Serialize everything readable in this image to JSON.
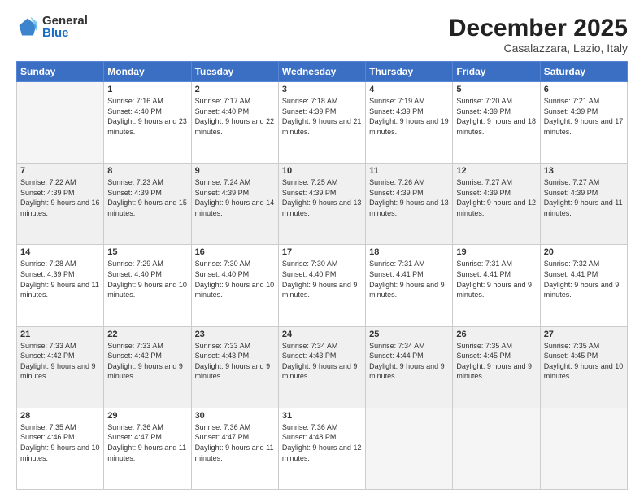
{
  "logo": {
    "general": "General",
    "blue": "Blue"
  },
  "header": {
    "month": "December 2025",
    "location": "Casalazzara, Lazio, Italy"
  },
  "days_of_week": [
    "Sunday",
    "Monday",
    "Tuesday",
    "Wednesday",
    "Thursday",
    "Friday",
    "Saturday"
  ],
  "weeks": [
    [
      {
        "day": "",
        "empty": true
      },
      {
        "day": "1",
        "sunrise": "7:16 AM",
        "sunset": "4:40 PM",
        "daylight": "9 hours and 23 minutes."
      },
      {
        "day": "2",
        "sunrise": "7:17 AM",
        "sunset": "4:40 PM",
        "daylight": "9 hours and 22 minutes."
      },
      {
        "day": "3",
        "sunrise": "7:18 AM",
        "sunset": "4:39 PM",
        "daylight": "9 hours and 21 minutes."
      },
      {
        "day": "4",
        "sunrise": "7:19 AM",
        "sunset": "4:39 PM",
        "daylight": "9 hours and 19 minutes."
      },
      {
        "day": "5",
        "sunrise": "7:20 AM",
        "sunset": "4:39 PM",
        "daylight": "9 hours and 18 minutes."
      },
      {
        "day": "6",
        "sunrise": "7:21 AM",
        "sunset": "4:39 PM",
        "daylight": "9 hours and 17 minutes."
      }
    ],
    [
      {
        "day": "7",
        "sunrise": "7:22 AM",
        "sunset": "4:39 PM",
        "daylight": "9 hours and 16 minutes."
      },
      {
        "day": "8",
        "sunrise": "7:23 AM",
        "sunset": "4:39 PM",
        "daylight": "9 hours and 15 minutes."
      },
      {
        "day": "9",
        "sunrise": "7:24 AM",
        "sunset": "4:39 PM",
        "daylight": "9 hours and 14 minutes."
      },
      {
        "day": "10",
        "sunrise": "7:25 AM",
        "sunset": "4:39 PM",
        "daylight": "9 hours and 13 minutes."
      },
      {
        "day": "11",
        "sunrise": "7:26 AM",
        "sunset": "4:39 PM",
        "daylight": "9 hours and 13 minutes."
      },
      {
        "day": "12",
        "sunrise": "7:27 AM",
        "sunset": "4:39 PM",
        "daylight": "9 hours and 12 minutes."
      },
      {
        "day": "13",
        "sunrise": "7:27 AM",
        "sunset": "4:39 PM",
        "daylight": "9 hours and 11 minutes."
      }
    ],
    [
      {
        "day": "14",
        "sunrise": "7:28 AM",
        "sunset": "4:39 PM",
        "daylight": "9 hours and 11 minutes."
      },
      {
        "day": "15",
        "sunrise": "7:29 AM",
        "sunset": "4:40 PM",
        "daylight": "9 hours and 10 minutes."
      },
      {
        "day": "16",
        "sunrise": "7:30 AM",
        "sunset": "4:40 PM",
        "daylight": "9 hours and 10 minutes."
      },
      {
        "day": "17",
        "sunrise": "7:30 AM",
        "sunset": "4:40 PM",
        "daylight": "9 hours and 9 minutes."
      },
      {
        "day": "18",
        "sunrise": "7:31 AM",
        "sunset": "4:41 PM",
        "daylight": "9 hours and 9 minutes."
      },
      {
        "day": "19",
        "sunrise": "7:31 AM",
        "sunset": "4:41 PM",
        "daylight": "9 hours and 9 minutes."
      },
      {
        "day": "20",
        "sunrise": "7:32 AM",
        "sunset": "4:41 PM",
        "daylight": "9 hours and 9 minutes."
      }
    ],
    [
      {
        "day": "21",
        "sunrise": "7:33 AM",
        "sunset": "4:42 PM",
        "daylight": "9 hours and 9 minutes."
      },
      {
        "day": "22",
        "sunrise": "7:33 AM",
        "sunset": "4:42 PM",
        "daylight": "9 hours and 9 minutes."
      },
      {
        "day": "23",
        "sunrise": "7:33 AM",
        "sunset": "4:43 PM",
        "daylight": "9 hours and 9 minutes."
      },
      {
        "day": "24",
        "sunrise": "7:34 AM",
        "sunset": "4:43 PM",
        "daylight": "9 hours and 9 minutes."
      },
      {
        "day": "25",
        "sunrise": "7:34 AM",
        "sunset": "4:44 PM",
        "daylight": "9 hours and 9 minutes."
      },
      {
        "day": "26",
        "sunrise": "7:35 AM",
        "sunset": "4:45 PM",
        "daylight": "9 hours and 9 minutes."
      },
      {
        "day": "27",
        "sunrise": "7:35 AM",
        "sunset": "4:45 PM",
        "daylight": "9 hours and 10 minutes."
      }
    ],
    [
      {
        "day": "28",
        "sunrise": "7:35 AM",
        "sunset": "4:46 PM",
        "daylight": "9 hours and 10 minutes."
      },
      {
        "day": "29",
        "sunrise": "7:36 AM",
        "sunset": "4:47 PM",
        "daylight": "9 hours and 11 minutes."
      },
      {
        "day": "30",
        "sunrise": "7:36 AM",
        "sunset": "4:47 PM",
        "daylight": "9 hours and 11 minutes."
      },
      {
        "day": "31",
        "sunrise": "7:36 AM",
        "sunset": "4:48 PM",
        "daylight": "9 hours and 12 minutes."
      },
      {
        "day": "",
        "empty": true
      },
      {
        "day": "",
        "empty": true
      },
      {
        "day": "",
        "empty": true
      }
    ]
  ]
}
